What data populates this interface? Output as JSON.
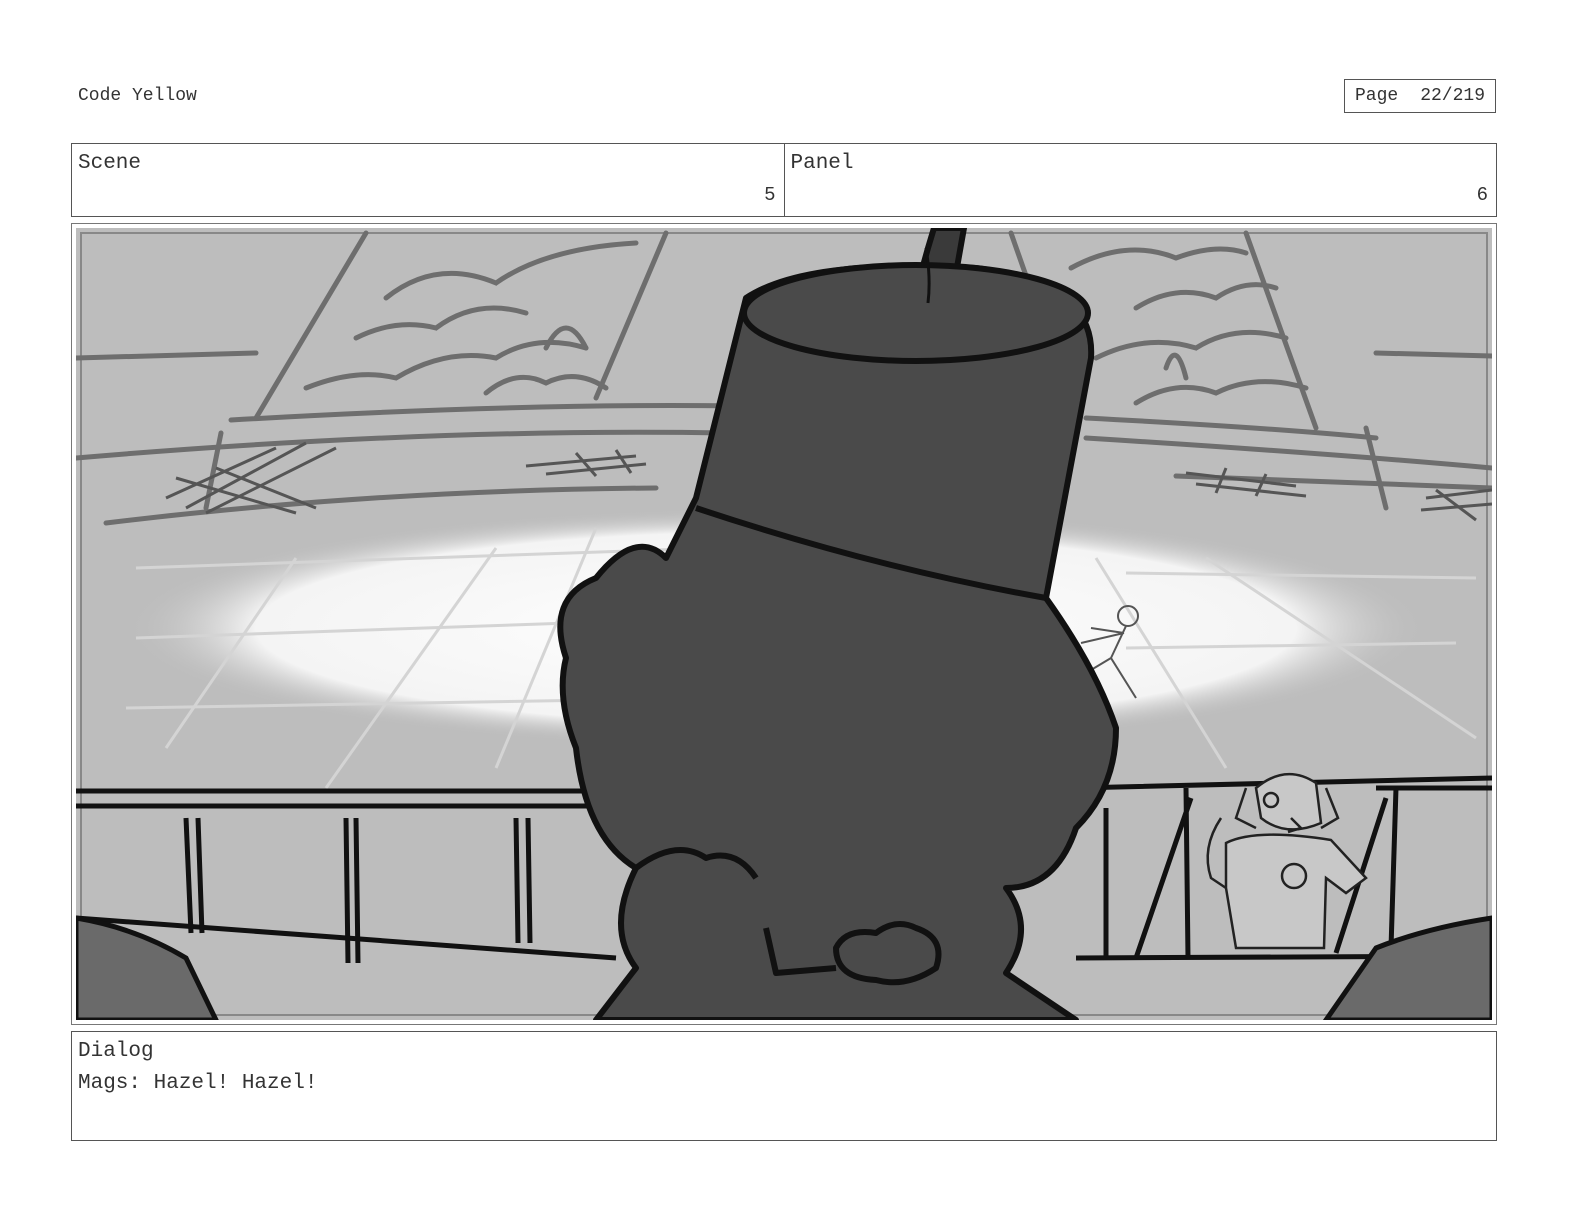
{
  "document": {
    "project_title": "Code Yellow",
    "page_label": "Page",
    "page_value": "22/219"
  },
  "header": {
    "scene_label": "Scene",
    "scene_value": "5",
    "panel_label": "Panel",
    "panel_value": "6"
  },
  "dialog": {
    "label": "Dialog",
    "text": "Mags: Hazel! Hazel!"
  },
  "artwork": {
    "icon": "storyboard-sketch",
    "palette": {
      "background": "#bdbdbd",
      "spotlight": "#ffffff",
      "figure": "#4a4a4a",
      "ink": "#111111",
      "sketch": "#6e6e6e"
    }
  }
}
